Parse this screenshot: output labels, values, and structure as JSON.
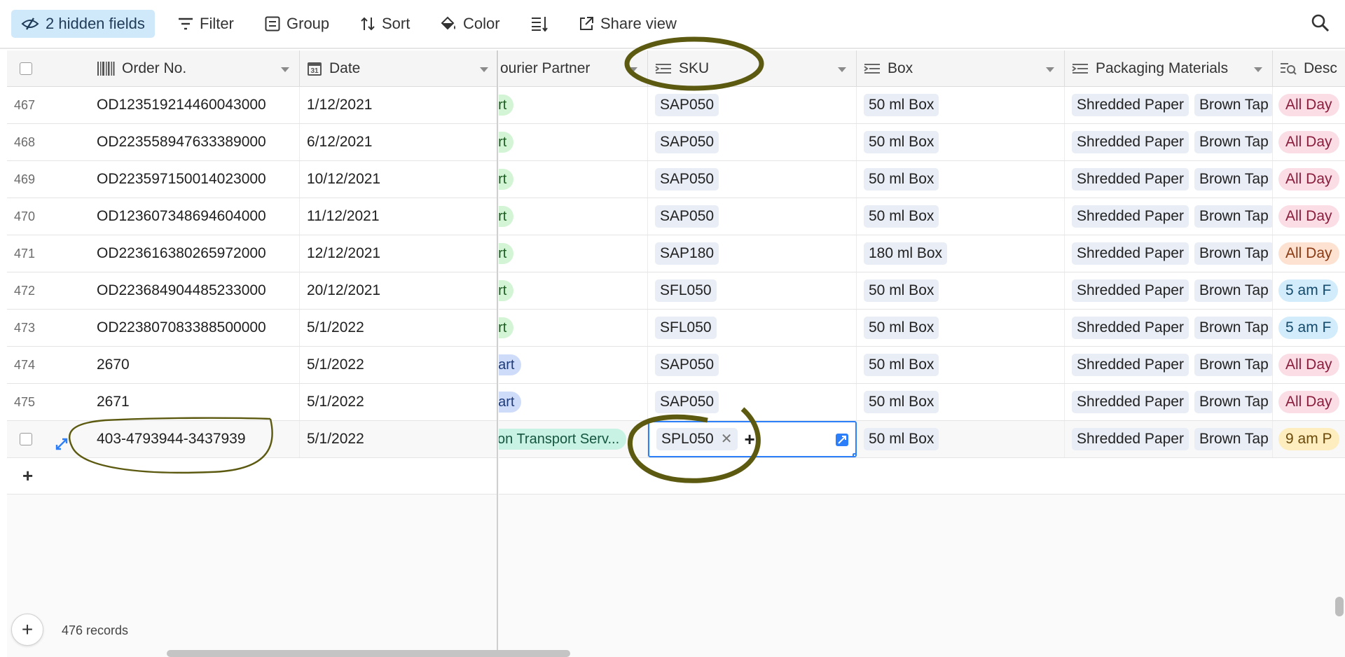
{
  "toolbar": {
    "hidden_fields": "2 hidden fields",
    "filter": "Filter",
    "group": "Group",
    "sort": "Sort",
    "color": "Color",
    "share": "Share view"
  },
  "columns": {
    "order_no": "Order No.",
    "date": "Date",
    "courier": "ourier Partner",
    "sku": "SKU",
    "box": "Box",
    "packaging": "Packaging Materials",
    "desc": "Desc"
  },
  "rows": [
    {
      "num": "467",
      "order": "OD123519214460043000",
      "date": "1/12/2021",
      "courier": "art",
      "courier_color": "green",
      "sku": "SAP050",
      "box": "50 ml Box",
      "pack1": "Shredded Paper",
      "pack2": "Brown Tap",
      "desc": "All Day",
      "desc_bg": "#fbdde6",
      "desc_fg": "#8a1c3c"
    },
    {
      "num": "468",
      "order": "OD223558947633389000",
      "date": "6/12/2021",
      "courier": "art",
      "courier_color": "green",
      "sku": "SAP050",
      "box": "50 ml Box",
      "pack1": "Shredded Paper",
      "pack2": "Brown Tap",
      "desc": "All Day",
      "desc_bg": "#fbdde6",
      "desc_fg": "#8a1c3c"
    },
    {
      "num": "469",
      "order": "OD223597150014023000",
      "date": "10/12/2021",
      "courier": "art",
      "courier_color": "green",
      "sku": "SAP050",
      "box": "50 ml Box",
      "pack1": "Shredded Paper",
      "pack2": "Brown Tap",
      "desc": "All Day",
      "desc_bg": "#fbdde6",
      "desc_fg": "#8a1c3c"
    },
    {
      "num": "470",
      "order": "OD123607348694604000",
      "date": "11/12/2021",
      "courier": "art",
      "courier_color": "green",
      "sku": "SAP050",
      "box": "50 ml Box",
      "pack1": "Shredded Paper",
      "pack2": "Brown Tap",
      "desc": "All Day",
      "desc_bg": "#fbdde6",
      "desc_fg": "#8a1c3c"
    },
    {
      "num": "471",
      "order": "OD223616380265972000",
      "date": "12/12/2021",
      "courier": "art",
      "courier_color": "green",
      "sku": "SAP180",
      "box": "180 ml Box",
      "pack1": "Shredded Paper",
      "pack2": "Brown Tap",
      "desc": "All Day",
      "desc_bg": "#fde2d2",
      "desc_fg": "#8a3a12"
    },
    {
      "num": "472",
      "order": "OD223684904485233000",
      "date": "20/12/2021",
      "courier": "art",
      "courier_color": "green",
      "sku": "SFL050",
      "box": "50 ml Box",
      "pack1": "Shredded Paper",
      "pack2": "Brown Tap",
      "desc": "5 am F",
      "desc_bg": "#d2ecfb",
      "desc_fg": "#144a6b"
    },
    {
      "num": "473",
      "order": "OD223807083388500000",
      "date": "5/1/2022",
      "courier": "art",
      "courier_color": "green",
      "sku": "SFL050",
      "box": "50 ml Box",
      "pack1": "Shredded Paper",
      "pack2": "Brown Tap",
      "desc": "5 am F",
      "desc_bg": "#d2ecfb",
      "desc_fg": "#144a6b"
    },
    {
      "num": "474",
      "order": "2670",
      "date": "5/1/2022",
      "courier": "dart",
      "courier_color": "blue",
      "sku": "SAP050",
      "box": "50 ml Box",
      "pack1": "Shredded Paper",
      "pack2": "Brown Tap",
      "desc": "All Day",
      "desc_bg": "#fbdde6",
      "desc_fg": "#8a1c3c"
    },
    {
      "num": "475",
      "order": "2671",
      "date": "5/1/2022",
      "courier": "dart",
      "courier_color": "blue",
      "sku": "SAP050",
      "box": "50 ml Box",
      "pack1": "Shredded Paper",
      "pack2": "Brown Tap",
      "desc": "All Day",
      "desc_bg": "#fbdde6",
      "desc_fg": "#8a1c3c"
    },
    {
      "num": "",
      "order": "403-4793944-3437939",
      "date": "5/1/2022",
      "courier": "zon Transport Serv...",
      "courier_color": "teal",
      "sku": "SPL050",
      "box": "50 ml Box",
      "pack1": "Shredded Paper",
      "pack2": "Brown Tap",
      "desc": "9 am P",
      "desc_bg": "#fdedbf",
      "desc_fg": "#6b4a0a"
    }
  ],
  "footer": {
    "add_symbol": "+",
    "records": "476 records"
  },
  "colors": {
    "annotation": "#5c5a10",
    "selection": "#2d7ff9"
  }
}
